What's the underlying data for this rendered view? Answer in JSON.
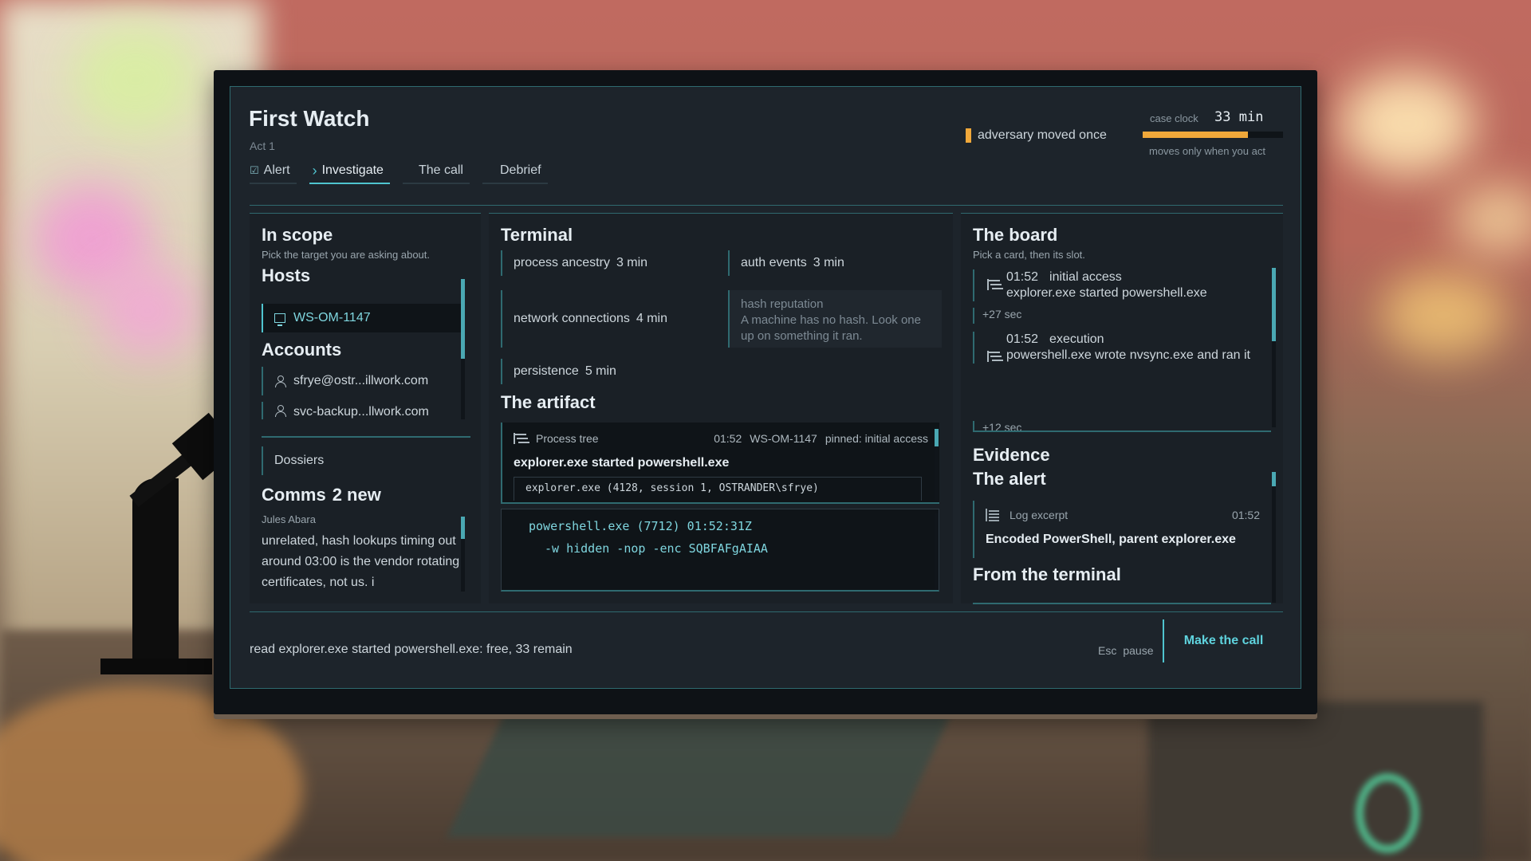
{
  "app": {
    "title": "First Watch",
    "act": "Act 1"
  },
  "tabs": [
    {
      "label": "Alert",
      "state": "done"
    },
    {
      "label": "Investigate",
      "state": "active"
    },
    {
      "label": "The call",
      "state": "pending"
    },
    {
      "label": "Debrief",
      "state": "pending"
    }
  ],
  "adversary": {
    "text": "adversary moved once",
    "color": "#f0a83a"
  },
  "clock": {
    "label": "case clock",
    "value": "33",
    "unit": "min",
    "note": "moves only when you act",
    "fill_fraction": 0.75
  },
  "scope": {
    "title": "In scope",
    "hint": "Pick the target you are asking about.",
    "hosts_title": "Hosts",
    "hosts": [
      {
        "name": "WS-OM-1147",
        "icon": "monitor-icon"
      }
    ],
    "accounts_title": "Accounts",
    "accounts": [
      {
        "name": "sfrye@ostr...illwork.com",
        "icon": "user-icon"
      },
      {
        "name": "svc-backup...llwork.com",
        "icon": "user-icon"
      }
    ],
    "dossiers_label": "Dossiers"
  },
  "comms": {
    "title": "Comms",
    "badge": "2 new",
    "sender": "Jules Abara",
    "message": "unrelated, hash lookups timing out around 03:00 is the vendor rotating certificates, not us. i"
  },
  "terminal": {
    "title": "Terminal",
    "commands": [
      {
        "label": "process ancestry",
        "cost": "3 min"
      },
      {
        "label": "auth events",
        "cost": "3 min"
      },
      {
        "label": "network connections",
        "cost": "4 min"
      },
      {
        "label": "persistence",
        "cost": "5 min"
      }
    ],
    "disabled": {
      "label": "hash reputation",
      "reason": "A machine has no hash. Look one up on something it ran."
    }
  },
  "artifact": {
    "title": "The artifact",
    "kind": "Process tree",
    "time": "01:52",
    "host": "WS-OM-1147",
    "pin": "pinned: initial access",
    "headline": "explorer.exe started powershell.exe",
    "parent_line": "explorer.exe (4128, session 1, OSTRANDER\\sfrye)",
    "child_line": "powershell.exe (7712) 01:52:31Z",
    "args_line": "-w hidden -nop -enc SQBFAFgAIAA"
  },
  "board": {
    "title": "The board",
    "hint": "Pick a card, then its slot.",
    "cards": [
      {
        "time": "01:52",
        "stage": "initial access",
        "text": "explorer.exe started powershell.exe"
      },
      {
        "time": "01:52",
        "stage": "execution",
        "text": "powershell.exe wrote nvsync.exe and ran it"
      }
    ],
    "gaps": [
      "+27 sec",
      "+12 sec"
    ]
  },
  "evidence": {
    "title": "Evidence",
    "alert_title": "The alert",
    "alert_kind": "Log excerpt",
    "alert_time": "01:52",
    "alert_text": "Encoded PowerShell, parent explorer.exe",
    "terminal_title": "From the terminal"
  },
  "footer": {
    "status": "read explorer.exe started powershell.exe: free, 33 remain",
    "esc_key": "Esc",
    "esc_label": "pause",
    "make_call": "Make the call"
  }
}
